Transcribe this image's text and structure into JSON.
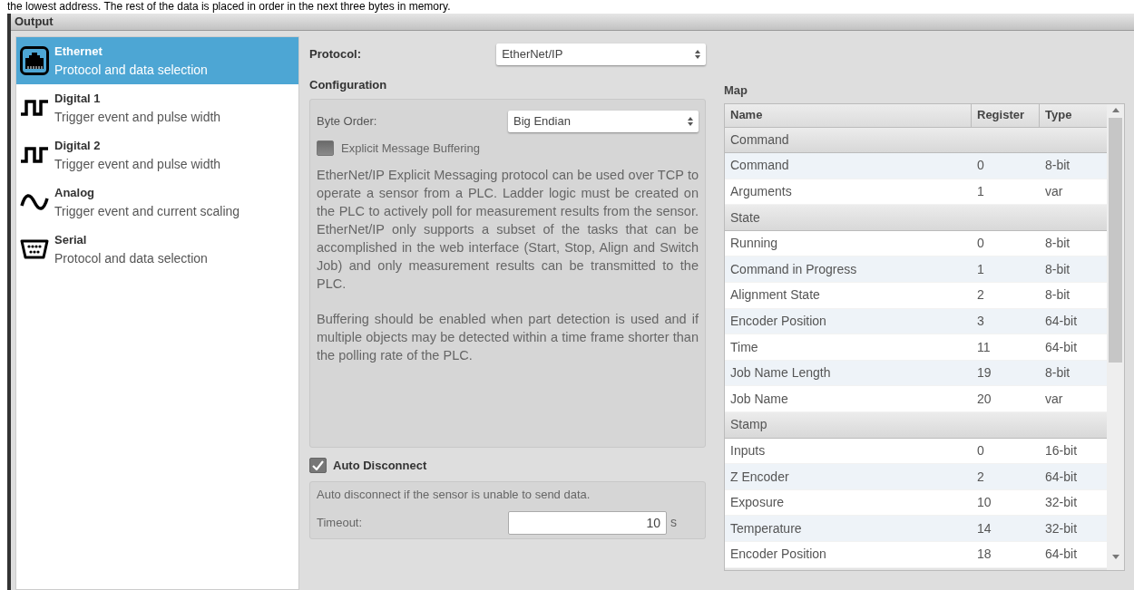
{
  "background_text": "the lowest address. The rest of the data is placed in order in the next three bytes in memory.",
  "window": {
    "title": "Output"
  },
  "sidebar": {
    "items": [
      {
        "kind": "ethernet",
        "title": "Ethernet",
        "subtitle": "Protocol and data selection",
        "selected": true
      },
      {
        "kind": "pulse",
        "title": "Digital 1",
        "subtitle": "Trigger event and pulse width",
        "selected": false
      },
      {
        "kind": "pulse",
        "title": "Digital 2",
        "subtitle": "Trigger event and pulse width",
        "selected": false
      },
      {
        "kind": "sine",
        "title": "Analog",
        "subtitle": "Trigger event and current scaling",
        "selected": false
      },
      {
        "kind": "serial",
        "title": "Serial",
        "subtitle": "Protocol and data selection",
        "selected": false
      }
    ]
  },
  "protocol": {
    "label": "Protocol:",
    "value": "EtherNet/IP"
  },
  "configuration": {
    "title": "Configuration",
    "byte_order": {
      "label": "Byte Order:",
      "value": "Big Endian"
    },
    "buffering": {
      "label": "Explicit Message Buffering",
      "checked": false
    },
    "description": [
      "EtherNet/IP Explicit Messaging protocol can be used over TCP to operate a sensor from a PLC. Ladder logic must be created on the PLC to actively poll for measurement results from the sensor. EtherNet/IP only supports a subset of the tasks that can be accomplished in the web interface (Start, Stop, Align and Switch Job) and only measurement results can be transmitted to the PLC.",
      "Buffering should be enabled when part detection is used and if multiple objects may be detected within a time frame shorter than the polling rate of the PLC."
    ]
  },
  "auto_disconnect": {
    "label": "Auto Disconnect",
    "checked": true,
    "description": "Auto disconnect if the sensor is unable to send data.",
    "timeout": {
      "label": "Timeout:",
      "value": "10",
      "unit": "s"
    }
  },
  "map": {
    "title": "Map",
    "columns": [
      "Name",
      "Register",
      "Type"
    ],
    "rows": [
      {
        "kind": "group",
        "name": "Command"
      },
      {
        "kind": "entry",
        "name": "Command",
        "register": "0",
        "type": "8-bit"
      },
      {
        "kind": "entry",
        "name": "Arguments",
        "register": "1",
        "type": "var"
      },
      {
        "kind": "group",
        "name": "State"
      },
      {
        "kind": "entry",
        "name": "Running",
        "register": "0",
        "type": "8-bit"
      },
      {
        "kind": "entry",
        "name": "Command in Progress",
        "register": "1",
        "type": "8-bit"
      },
      {
        "kind": "entry",
        "name": "Alignment State",
        "register": "2",
        "type": "8-bit"
      },
      {
        "kind": "entry",
        "name": "Encoder Position",
        "register": "3",
        "type": "64-bit"
      },
      {
        "kind": "entry",
        "name": "Time",
        "register": "11",
        "type": "64-bit"
      },
      {
        "kind": "entry",
        "name": "Job Name Length",
        "register": "19",
        "type": "8-bit"
      },
      {
        "kind": "entry",
        "name": "Job Name",
        "register": "20",
        "type": "var"
      },
      {
        "kind": "group",
        "name": "Stamp"
      },
      {
        "kind": "entry",
        "name": "Inputs",
        "register": "0",
        "type": "16-bit"
      },
      {
        "kind": "entry",
        "name": "Z Encoder",
        "register": "2",
        "type": "64-bit"
      },
      {
        "kind": "entry",
        "name": "Exposure",
        "register": "10",
        "type": "32-bit"
      },
      {
        "kind": "entry",
        "name": "Temperature",
        "register": "14",
        "type": "32-bit"
      },
      {
        "kind": "entry",
        "name": "Encoder Position",
        "register": "18",
        "type": "64-bit"
      }
    ]
  }
}
